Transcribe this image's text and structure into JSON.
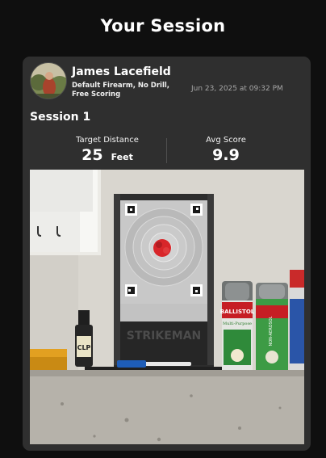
{
  "header": {
    "title": "Your Session"
  },
  "profile": {
    "name": "James Lacefield",
    "subtitle": "Default Firearm, No Drill, Free Scoring",
    "date": "Jun 23, 2025 at 09:32 PM"
  },
  "session": {
    "title": "Session 1",
    "distance_label": "Target Distance",
    "distance_value": "25",
    "distance_unit": "Feet",
    "score_label": "Avg Score",
    "score_value": "9.9"
  },
  "photo": {
    "target_brand": "STRIKEMAN",
    "cleaner_label": "CLP",
    "can_brand": "BALLISTOL",
    "can_subtitle": "Multi-Purpose",
    "can2_label": "NON-AEROSOL"
  }
}
